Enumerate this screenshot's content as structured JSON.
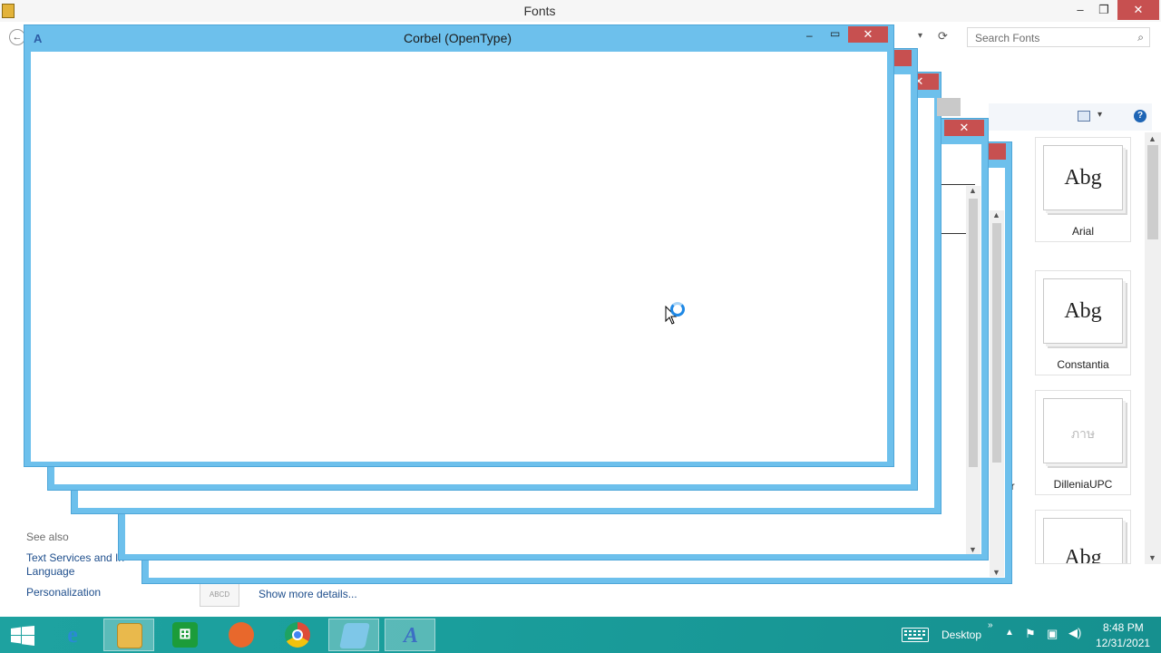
{
  "explorer": {
    "title": "Fonts",
    "search_placeholder": "Search Fonts",
    "window_controls": {
      "minimize": "–",
      "maximize": "❐",
      "close": "✕"
    },
    "font_tiles": [
      {
        "sample": "Abg",
        "name": "Arial"
      },
      {
        "sample": "Abg",
        "name": "Constantia"
      },
      {
        "sample": "ภาษ",
        "name": "DilleniaUPC"
      },
      {
        "sample": "Abg",
        "name": ""
      }
    ],
    "partial_label": "ar",
    "see_also": "See also",
    "links": [
      "Text Services and In",
      "Language",
      "Personalization"
    ],
    "details_icon_text": "ABCD",
    "show_more": "Show more details..."
  },
  "preview_window": {
    "title": "Corbel (OpenType)",
    "min": "–",
    "max": "▭",
    "close": "✕"
  },
  "taskbar": {
    "desktop_label": "Desktop",
    "time": "8:48 PM",
    "date": "12/31/2021",
    "apps": [
      {
        "icon": "internet-explorer-icon",
        "color": "#2a8ad4"
      },
      {
        "icon": "file-explorer-icon",
        "color": "#e9b94c"
      },
      {
        "icon": "store-icon",
        "color": "#1c9c3a"
      },
      {
        "icon": "firefox-icon",
        "color": "#e8682c"
      },
      {
        "icon": "chrome-icon",
        "color": "#dd4b39"
      },
      {
        "icon": "notepad-icon",
        "color": "#7ec7e8"
      },
      {
        "icon": "font-viewer-icon",
        "color": "#3c6fc4"
      }
    ]
  }
}
